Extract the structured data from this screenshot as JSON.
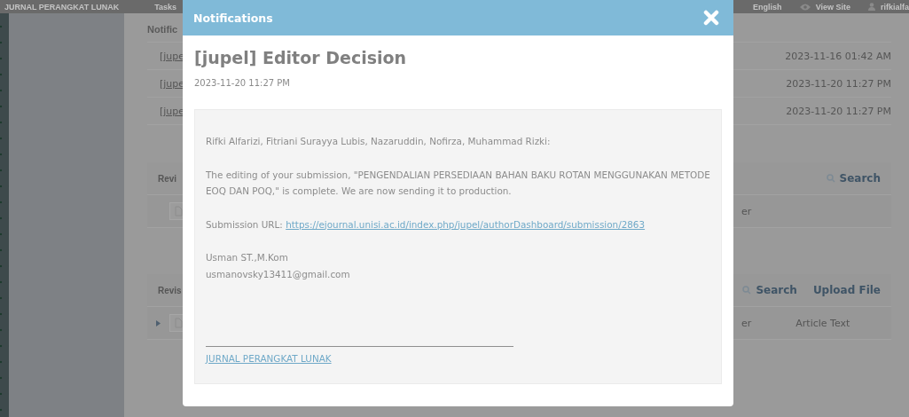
{
  "top_bar": {
    "site_title": "JURNAL PERANGKAT LUNAK",
    "tasks": "Tasks",
    "language": "English",
    "view_site": "View Site",
    "user": "rifkialfa"
  },
  "background": {
    "notifications_panel": {
      "title": "Notific",
      "rows": [
        {
          "subject": "[jupe",
          "date": "2023-11-16 01:42 AM"
        },
        {
          "subject": "[jupe",
          "date": "2023-11-20 11:27 PM"
        },
        {
          "subject": "[jupe",
          "date": "2023-11-20 11:27 PM"
        }
      ]
    },
    "sections": [
      {
        "title": "Revi",
        "actions": [
          "Search"
        ],
        "rows": [
          {
            "expandable": false,
            "column_2": "er"
          }
        ]
      },
      {
        "title": "Revis",
        "actions": [
          "Search",
          "Upload File"
        ],
        "rows": [
          {
            "expandable": true,
            "column_2": "er",
            "column_3": "Article Text"
          }
        ]
      }
    ]
  },
  "modal": {
    "title": "Notifications",
    "heading": "[jupel] Editor Decision",
    "date": "2023-11-20 11:27 PM",
    "greeting": "Rifki Alfarizi, Fitriani Surayya Lubis, Nazaruddin, Nofirza, Muhammad Rizki:",
    "paragraph": "The editing of your submission, \"PENGENDALIAN PERSEDIAAN BAHAN BAKU ROTAN MENGGUNAKAN METODE EOQ DAN POQ,\" is complete. We are now sending it to production.",
    "url_label": "Submission URL:",
    "url": "https://ejournal.unisi.ac.id/index.php/jupel/authorDashboard/submission/2863",
    "signature": [
      "Usman ST.,M.Kom",
      "usmanovsky13411@gmail.com"
    ],
    "footer_link": "JURNAL PERANGKAT LUNAK"
  }
}
